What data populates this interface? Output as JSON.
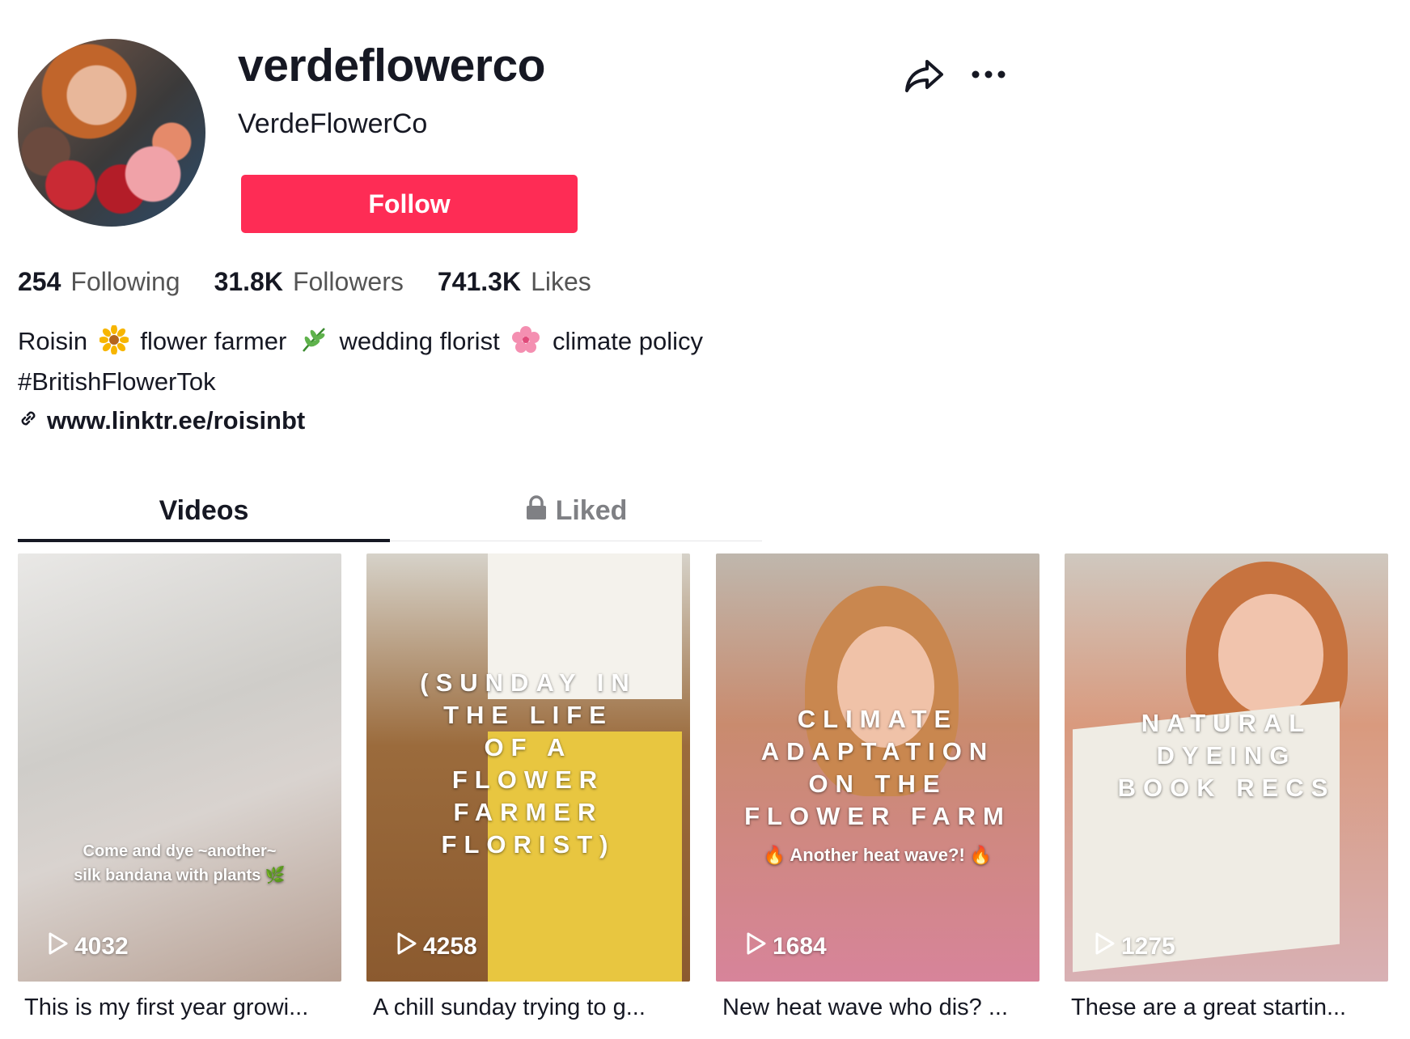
{
  "profile": {
    "username": "verdeflowerco",
    "display_name": "VerdeFlowerCo",
    "follow_label": "Follow"
  },
  "stats": [
    {
      "value": "254",
      "label": "Following"
    },
    {
      "value": "31.8K",
      "label": "Followers"
    },
    {
      "value": "741.3K",
      "label": "Likes"
    }
  ],
  "bio": {
    "line1": [
      "Roisin",
      "flower farmer",
      "wedding florist",
      "climate policy"
    ],
    "line2": "#BritishFlowerTok",
    "link": "www.linktr.ee/roisinbt"
  },
  "tabs": {
    "videos": "Videos",
    "liked": "Liked"
  },
  "videos": [
    {
      "overlay": "Come and dye ~another~\nsilk bandana with plants 🌿",
      "views": "4032",
      "caption": "This is my first year growi..."
    },
    {
      "overlay": "(SUNDAY IN\nTHE LIFE\nOF A\nFLOWER\nFARMER\nFLORIST)",
      "views": "4258",
      "caption": "A chill sunday trying to g..."
    },
    {
      "overlay": "CLIMATE\nADAPTATION\nON THE\nFLOWER FARM",
      "sub_overlay": "🔥 Another heat wave?! 🔥",
      "views": "1684",
      "caption": "New heat wave who dis? ..."
    },
    {
      "overlay": "NATURAL\nDYEING\nBOOK RECS",
      "views": "1275",
      "caption": "These are a great startin..."
    }
  ],
  "colors": {
    "accent": "#fe2c55",
    "text": "#161823",
    "muted": "#555555"
  }
}
